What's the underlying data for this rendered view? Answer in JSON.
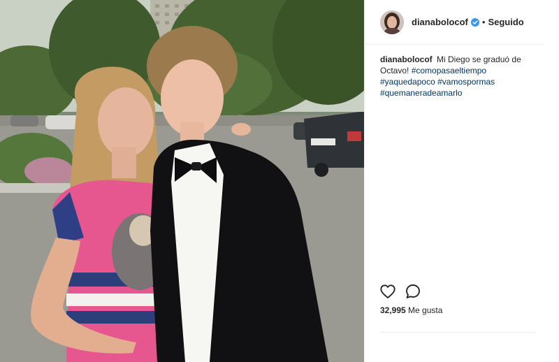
{
  "header": {
    "username": "dianabolocof",
    "verified_icon": "verified-badge-icon",
    "separator": "•",
    "follow_status": "Seguido"
  },
  "caption": {
    "username": "dianabolocof",
    "text": "Mi Diego se graduó de Octavo!",
    "hashtags": [
      "#comopasaeltiempo",
      "#yaquedapoco",
      "#vamospormas",
      "#quemaneradeamarlo"
    ]
  },
  "actions": {
    "like_icon": "heart-icon",
    "comment_icon": "comment-icon"
  },
  "likes": {
    "count": "32,995",
    "label": "Me gusta"
  },
  "colors": {
    "hashtag": "#003569",
    "text": "#262626",
    "verified": "#3897f0",
    "divider": "#efefef"
  }
}
